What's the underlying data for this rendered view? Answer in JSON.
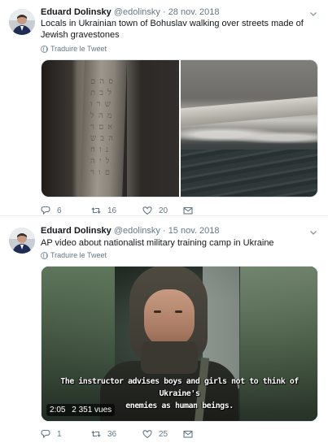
{
  "tweets": [
    {
      "author": {
        "name": "Eduard Dolinsky",
        "handle": "@edolinsky"
      },
      "date": "28 nov. 2018",
      "text": "Locals in Ukrainian town of Bohuslav walking over streets made of Jewish gravestones",
      "translate": "Traduire le Tweet",
      "media": {
        "kind": "photos",
        "count": 2
      },
      "stats": {
        "replies": "6",
        "retweets": "16",
        "likes": "20"
      }
    },
    {
      "author": {
        "name": "Eduard Dolinsky",
        "handle": "@edolinsky"
      },
      "date": "15 nov. 2018",
      "text": "AP video about nationalist military training camp in Ukraine",
      "translate": "Traduire le Tweet",
      "media": {
        "kind": "video",
        "subtitle_line1": "The instructor advises boys and girls not to think of Ukraine's",
        "subtitle_line2": "enemies as human beings.",
        "duration": "2:05",
        "views": "2 351 vues"
      },
      "stats": {
        "replies": "1",
        "retweets": "36",
        "likes": "25"
      }
    }
  ],
  "separator": "·",
  "colors": {
    "text": "#14171a",
    "secondary": "#657786",
    "divider": "#e6ecf0"
  },
  "icons": [
    "chevron-down-icon",
    "globe-icon",
    "reply-icon",
    "retweet-icon",
    "like-icon",
    "message-icon"
  ]
}
